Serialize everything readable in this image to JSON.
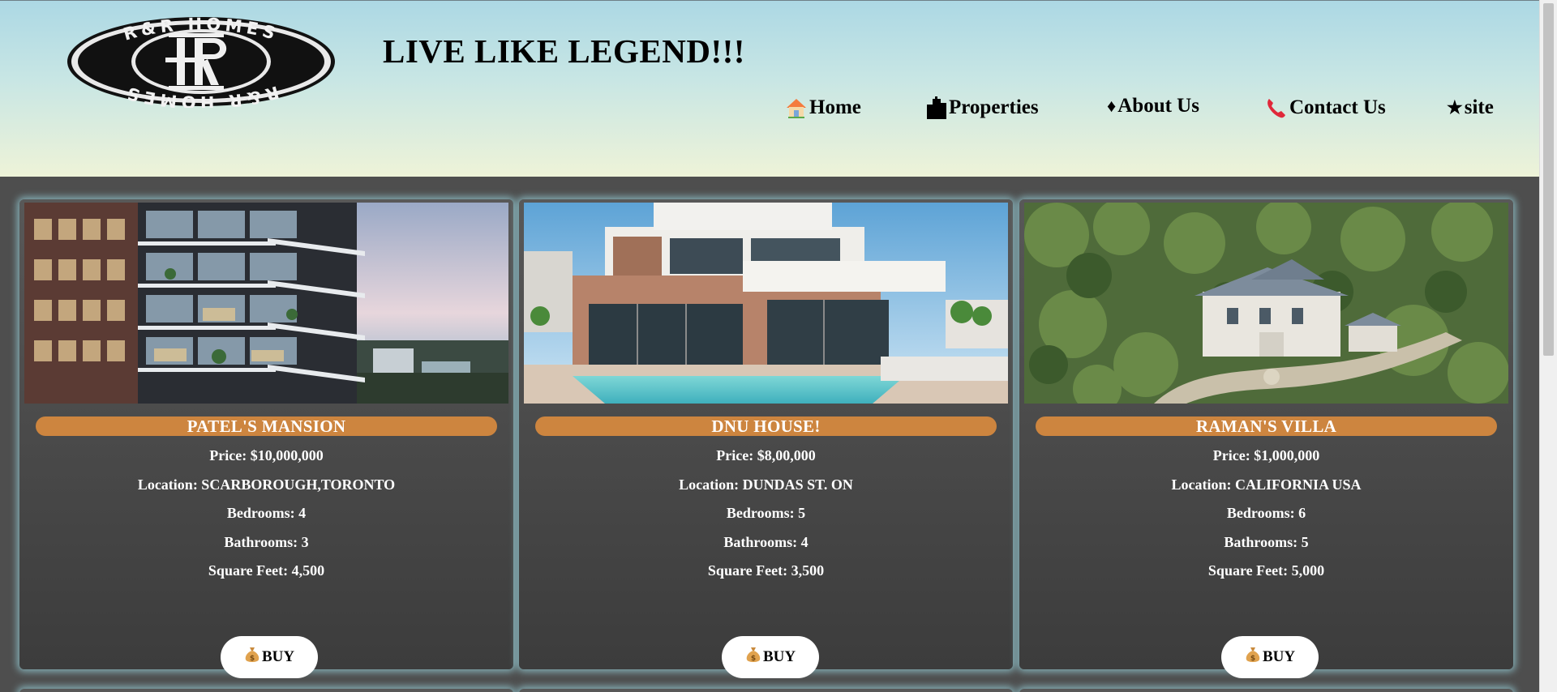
{
  "header": {
    "logo_text_top": "R&R HOMES",
    "logo_text_bottom": "R&R HOMES",
    "logo_monogram": "RR",
    "tagline": "LIVE LIKE LEGEND!!!"
  },
  "nav": {
    "items": [
      {
        "label": "Home",
        "icon": "house-icon"
      },
      {
        "label": "Properties",
        "icon": "buildings-icon"
      },
      {
        "label": "About Us",
        "glyph": "♦",
        "icon": "diamond-icon"
      },
      {
        "label": "Contact Us",
        "icon": "telephone-icon"
      },
      {
        "label": "site",
        "glyph": "★",
        "icon": "star-icon"
      }
    ]
  },
  "properties": [
    {
      "title": "PATEL'S MANSION",
      "price": "Price: $10,000,000",
      "location": "Location: SCARBOROUGH,TORONTO",
      "bedrooms": "Bedrooms: 4",
      "bathrooms": "Bathrooms: 3",
      "square_feet": "Square Feet: 4,500",
      "buy_label": "BUY",
      "image": "high-rise-balcony-photo"
    },
    {
      "title": "DNU HOUSE!",
      "price": "Price: $8,00,000",
      "location": "Location: DUNDAS ST. ON",
      "bedrooms": "Bedrooms: 5",
      "bathrooms": "Bathrooms: 4",
      "square_feet": "Square Feet: 3,500",
      "buy_label": "BUY",
      "image": "modern-villa-pool-photo"
    },
    {
      "title": "RAMAN'S VILLA",
      "price": "Price: $1,000,000",
      "location": "Location: CALIFORNIA USA",
      "bedrooms": "Bedrooms: 6",
      "bathrooms": "Bathrooms: 5",
      "square_feet": "Square Feet: 5,000",
      "buy_label": "BUY",
      "image": "aerial-estate-photo"
    }
  ],
  "colors": {
    "title_pill": "#cd853f",
    "card_glow": "#96cdd7",
    "header_top": "#acd8e4",
    "header_bottom": "#eef3d8"
  },
  "icons": {
    "buy": "money-bag-icon"
  }
}
